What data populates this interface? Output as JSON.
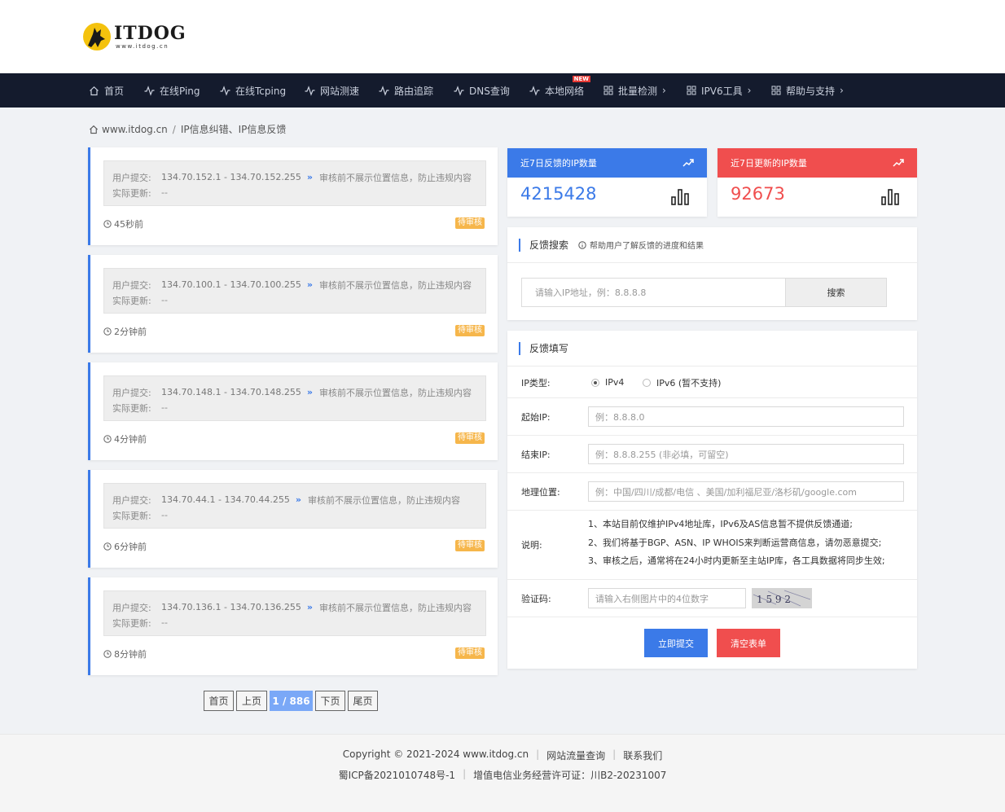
{
  "header": {
    "logo_title": "ITDOG",
    "logo_sub": "www.itdog.cn"
  },
  "nav": [
    {
      "label": "首页",
      "icon": "home-icon"
    },
    {
      "label": "在线Ping",
      "icon": "pulse-icon"
    },
    {
      "label": "在线Tcping",
      "icon": "pulse-icon"
    },
    {
      "label": "网站测速",
      "icon": "pulse-icon"
    },
    {
      "label": "路由追踪",
      "icon": "pulse-icon"
    },
    {
      "label": "DNS查询",
      "icon": "pulse-icon"
    },
    {
      "label": "本地网络",
      "icon": "pulse-icon",
      "badge": "NEW"
    },
    {
      "label": "批量检测",
      "icon": "grid-icon",
      "chevron": "›"
    },
    {
      "label": "IPV6工具",
      "icon": "grid-icon",
      "chevron": "›"
    },
    {
      "label": "帮助与支持",
      "icon": "grid-icon",
      "chevron": "›"
    }
  ],
  "breadcrumb": {
    "home": "www.itdog.cn",
    "separator": "/",
    "current": "IP信息纠错、IP信息反馈"
  },
  "feedback_labels": {
    "submitted": "用户提交:",
    "actual": "实际更新:",
    "arrow": "»"
  },
  "feedback_items": [
    {
      "range": "134.70.152.1 - 134.70.152.255",
      "note": "审核前不展示位置信息，防止违规内容",
      "actual": "--",
      "time": "45秒前",
      "status": "待审核"
    },
    {
      "range": "134.70.100.1 - 134.70.100.255",
      "note": "审核前不展示位置信息，防止违规内容",
      "actual": "--",
      "time": "2分钟前",
      "status": "待审核"
    },
    {
      "range": "134.70.148.1 - 134.70.148.255",
      "note": "审核前不展示位置信息，防止违规内容",
      "actual": "--",
      "time": "4分钟前",
      "status": "待审核"
    },
    {
      "range": "134.70.44.1 - 134.70.44.255",
      "note": "审核前不展示位置信息，防止违规内容",
      "actual": "--",
      "time": "6分钟前",
      "status": "待审核"
    },
    {
      "range": "134.70.136.1 - 134.70.136.255",
      "note": "审核前不展示位置信息，防止违规内容",
      "actual": "--",
      "time": "8分钟前",
      "status": "待审核"
    }
  ],
  "pagination": {
    "first": "首页",
    "prev": "上页",
    "current": "1 / 886",
    "next": "下页",
    "last": "尾页"
  },
  "stats": [
    {
      "title": "近7日反馈的IP数量",
      "value": "4215428",
      "color": "#3b7ae8"
    },
    {
      "title": "近7日更新的IP数量",
      "value": "92673",
      "color": "#f04e4e"
    }
  ],
  "search_panel": {
    "title": "反馈搜索",
    "hint": "帮助用户了解反馈的进度和结果",
    "placeholder": "请输入IP地址，例：8.8.8.8",
    "button": "搜索"
  },
  "form_panel": {
    "title": "反馈填写",
    "ip_type_label": "IP类型:",
    "ipv4": "IPv4",
    "ipv6": "IPv6 (暂不支持)",
    "start_label": "起始IP:",
    "start_placeholder": "例：8.8.8.0",
    "end_label": "结束IP:",
    "end_placeholder": "例：8.8.8.255 (非必填，可留空)",
    "geo_label": "地理位置:",
    "geo_placeholder": "例：中国/四川/成都/电信 、美国/加利福尼亚/洛杉矶/google.com",
    "notes_label": "说明:",
    "notes": [
      "1、本站目前仅维护IPv4地址库，IPv6及AS信息暂不提供反馈通道;",
      "2、我们将基于BGP、ASN、IP WHOIS来判断运营商信息，请勿恶意提交;",
      "3、审核之后，通常将在24小时内更新至主站IP库，各工具数据将同步生效;"
    ],
    "captcha_label": "验证码:",
    "captcha_placeholder": "请输入右侧图片中的4位数字",
    "captcha_text": "1 5 9 2",
    "submit": "立即提交",
    "clear": "清空表单",
    "submit_color": "#3b7ae8",
    "clear_color": "#f04e4e"
  },
  "footer": {
    "copyright": "Copyright © 2021-2024 www.itdog.cn",
    "traffic": "网站流量查询",
    "contact": "联系我们",
    "icp": "蜀ICP备2021010748号-1",
    "license": "增值电信业务经营许可证：川B2-20231007"
  }
}
